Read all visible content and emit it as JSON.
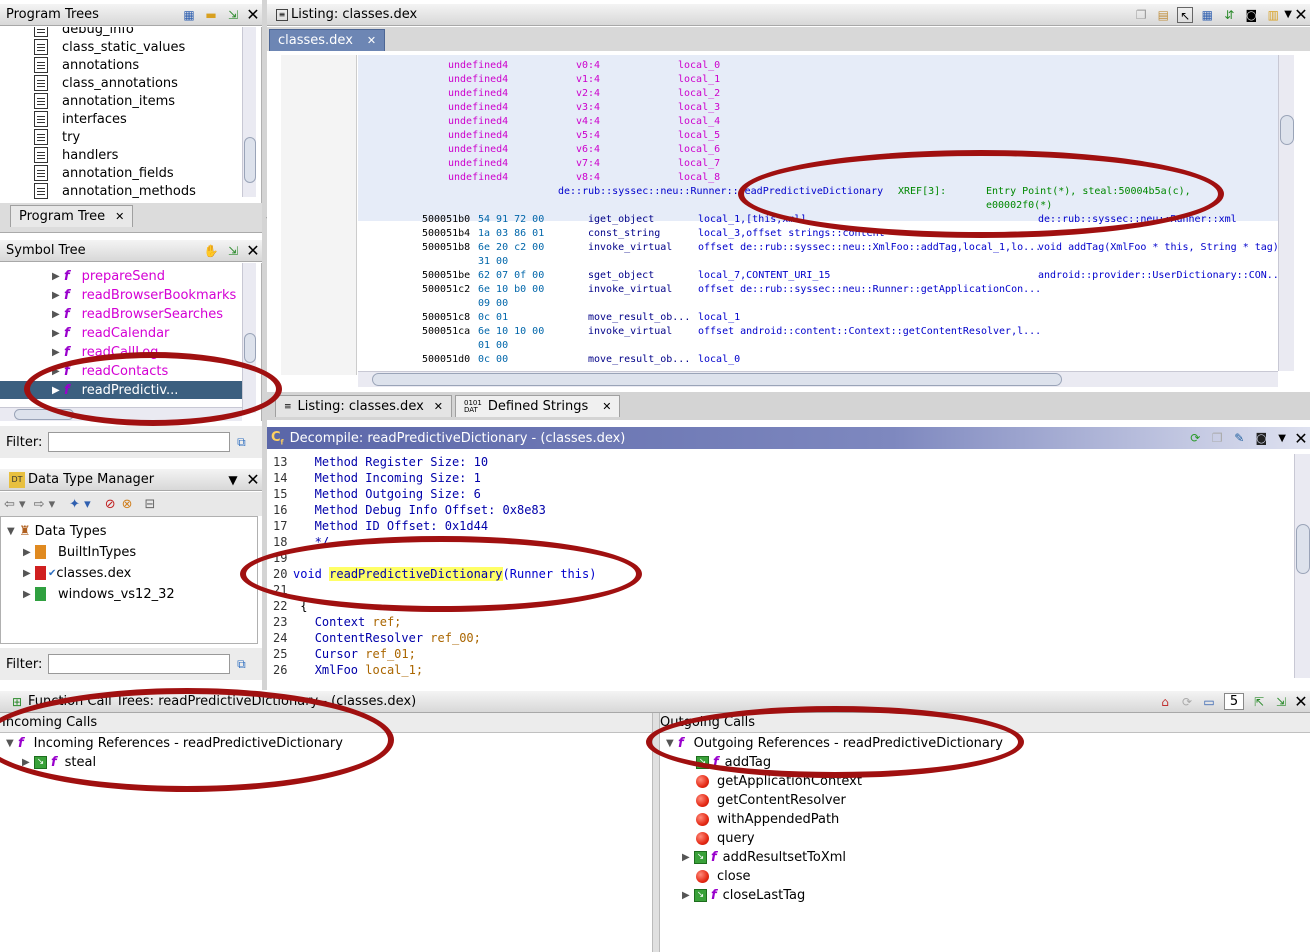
{
  "program_trees": {
    "title": "Program Trees",
    "items": [
      "class_static_values",
      "annotations",
      "class_annotations",
      "annotation_items",
      "interfaces",
      "try",
      "handlers",
      "annotation_fields",
      "annotation_methods"
    ],
    "partial_top": "debug_info",
    "tab_label": "Program Tree"
  },
  "symbol_tree": {
    "title": "Symbol Tree",
    "items": [
      "prepareSend",
      "readBrowserBookmarks",
      "readBrowserSearches",
      "readCalendar",
      "readCallLog",
      "readContacts",
      "readPredictiv..."
    ],
    "filter_label": "Filter:"
  },
  "data_type_manager": {
    "title": "Data Type Manager",
    "root": "Data Types",
    "items": [
      "BuiltInTypes",
      "classes.dex",
      "windows_vs12_32"
    ],
    "filter_label": "Filter:"
  },
  "listing": {
    "title": "Listing:  classes.dex",
    "tab_label": "classes.dex",
    "vars": [
      {
        "type": "undefined4",
        "reg": "v0:4",
        "name": "local_0"
      },
      {
        "type": "undefined4",
        "reg": "v1:4",
        "name": "local_1"
      },
      {
        "type": "undefined4",
        "reg": "v2:4",
        "name": "local_2"
      },
      {
        "type": "undefined4",
        "reg": "v3:4",
        "name": "local_3"
      },
      {
        "type": "undefined4",
        "reg": "v4:4",
        "name": "local_4"
      },
      {
        "type": "undefined4",
        "reg": "v5:4",
        "name": "local_5"
      },
      {
        "type": "undefined4",
        "reg": "v6:4",
        "name": "local_6"
      },
      {
        "type": "undefined4",
        "reg": "v7:4",
        "name": "local_7"
      },
      {
        "type": "undefined4",
        "reg": "v8:4",
        "name": "local_8"
      }
    ],
    "func_label": "de::rub::syssec::neu::Runner::readPredictiveDictionary",
    "xref": "XREF[3]:",
    "xref_entries": "Entry Point(*), steal:50004b5a(c),",
    "xref_entries2": "e00002f0(*)",
    "instructions": [
      {
        "addr": "500051b0",
        "bytes": "54 91 72 00",
        "mnem": "iget_object",
        "ops": "local_1,[this,xml]",
        "cmt": "de::rub::syssec::neu::Runner::xml"
      },
      {
        "addr": "500051b4",
        "bytes": "1a 03 86 01",
        "mnem": "const_string",
        "ops": "local_3,offset strings::content",
        "cmt": ""
      },
      {
        "addr": "500051b8",
        "bytes": "6e 20 c2 00",
        "mnem": "invoke_virtual",
        "ops": "offset de::rub::syssec::neu::XmlFoo::addTag,local_1,lo...",
        "cmt": "void addTag(XmlFoo * this, String * tag)"
      },
      {
        "addr": "",
        "bytes": "31 00",
        "mnem": "",
        "ops": "",
        "cmt": ""
      },
      {
        "addr": "500051be",
        "bytes": "62 07 0f 00",
        "mnem": "sget_object",
        "ops": "local_7,CONTENT_URI_15",
        "cmt": "android::provider::UserDictionary::CON..."
      },
      {
        "addr": "500051c2",
        "bytes": "6e 10 b0 00",
        "mnem": "invoke_virtual",
        "ops": "offset de::rub::syssec::neu::Runner::getApplicationCon...",
        "cmt": ""
      },
      {
        "addr": "",
        "bytes": "09 00",
        "mnem": "",
        "ops": "",
        "cmt": ""
      },
      {
        "addr": "500051c8",
        "bytes": "0c 01",
        "mnem": "move_result_ob...",
        "ops": "local_1",
        "cmt": ""
      },
      {
        "addr": "500051ca",
        "bytes": "6e 10 10 00",
        "mnem": "invoke_virtual",
        "ops": "offset android::content::Context::getContentResolver,l...",
        "cmt": ""
      },
      {
        "addr": "",
        "bytes": "01 00",
        "mnem": "",
        "ops": "",
        "cmt": ""
      },
      {
        "addr": "500051d0",
        "bytes": "0c 00",
        "mnem": "move_result_ob...",
        "ops": "local_0",
        "cmt": ""
      }
    ],
    "bottom_tabs": [
      "Listing:  classes.dex",
      "Defined Strings"
    ]
  },
  "decompile": {
    "title": "Decompile: readPredictiveDictionary -  (classes.dex)",
    "lines": [
      {
        "n": "13",
        "text": "  Method Register Size: 10"
      },
      {
        "n": "14",
        "text": "  Method Incoming Size: 1"
      },
      {
        "n": "15",
        "text": "  Method Outgoing Size: 6"
      },
      {
        "n": "16",
        "text": "  Method Debug Info Offset: 0x8e83"
      },
      {
        "n": "17",
        "text": "  Method ID Offset: 0x1d44"
      },
      {
        "n": "18",
        "text": "  */"
      },
      {
        "n": "19",
        "text": ""
      },
      {
        "n": "20",
        "text": ""
      },
      {
        "n": "21",
        "text": ""
      },
      {
        "n": "22",
        "text": "{"
      },
      {
        "n": "23",
        "text": "  Context ref;"
      },
      {
        "n": "24",
        "text": "  ContentResolver ref_00;"
      },
      {
        "n": "25",
        "text": "  Cursor ref_01;"
      },
      {
        "n": "26",
        "text": "  XmlFoo local_1;"
      }
    ],
    "sig_void": "void",
    "sig_name": "readPredictiveDictionary",
    "sig_params": "(Runner this)"
  },
  "call_trees": {
    "title": "Function Call Trees: readPredictiveDictionary -  (classes.dex)",
    "count": "5",
    "incoming_header": "Incoming Calls",
    "incoming_root": "Incoming References - readPredictiveDictionary",
    "incoming_items": [
      "steal"
    ],
    "outgoing_header": "Outgoing Calls",
    "outgoing_root": "Outgoing References - readPredictiveDictionary",
    "outgoing_items": [
      "addTag",
      "getApplicationContext",
      "getContentResolver",
      "withAppendedPath",
      "query",
      "addResultsetToXml",
      "close",
      "closeLastTag"
    ]
  }
}
